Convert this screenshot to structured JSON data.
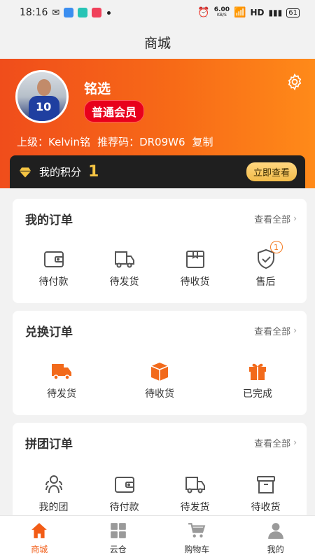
{
  "status_bar": {
    "time": "18:16",
    "net_speed": "6.00",
    "net_unit": "KB/S",
    "hd": "HD",
    "battery": "61"
  },
  "page_title": "商城",
  "profile": {
    "name": "铭选",
    "member_level": "普通会员",
    "superior_label": "上级：",
    "superior_name": "Kelvin铭",
    "ref_code_label": "推荐码：",
    "ref_code": "DR09W6",
    "copy_label": "复制",
    "avatar_number": "10"
  },
  "points": {
    "label": "我的积分",
    "value": "1",
    "check_label": "立即查看"
  },
  "my_orders": {
    "title": "我的订单",
    "view_all": "查看全部",
    "items": [
      {
        "label": "待付款",
        "icon": "wallet-icon"
      },
      {
        "label": "待发货",
        "icon": "truck-icon"
      },
      {
        "label": "待收货",
        "icon": "box-icon"
      },
      {
        "label": "售后",
        "icon": "shield-check-icon",
        "badge": "1"
      }
    ]
  },
  "exchange_orders": {
    "title": "兑换订单",
    "view_all": "查看全部",
    "items": [
      {
        "label": "待发货",
        "icon": "truck-icon"
      },
      {
        "label": "待收货",
        "icon": "box-icon"
      },
      {
        "label": "已完成",
        "icon": "gift-icon"
      }
    ]
  },
  "group_orders": {
    "title": "拼团订单",
    "view_all": "查看全部",
    "items": [
      {
        "label": "我的团",
        "icon": "group-icon"
      },
      {
        "label": "待付款",
        "icon": "wallet-icon"
      },
      {
        "label": "待发货",
        "icon": "truck-icon"
      },
      {
        "label": "待收货",
        "icon": "box-icon"
      }
    ]
  },
  "tab_bar": {
    "tabs": [
      {
        "label": "商城",
        "icon": "home-icon",
        "active": true
      },
      {
        "label": "云仓",
        "icon": "grid-icon"
      },
      {
        "label": "购物车",
        "icon": "cart-icon"
      },
      {
        "label": "我的",
        "icon": "person-icon"
      }
    ]
  },
  "colors": {
    "accent": "#f25c16",
    "badge_red": "#e8001c",
    "points_gold": "#f5c443"
  }
}
